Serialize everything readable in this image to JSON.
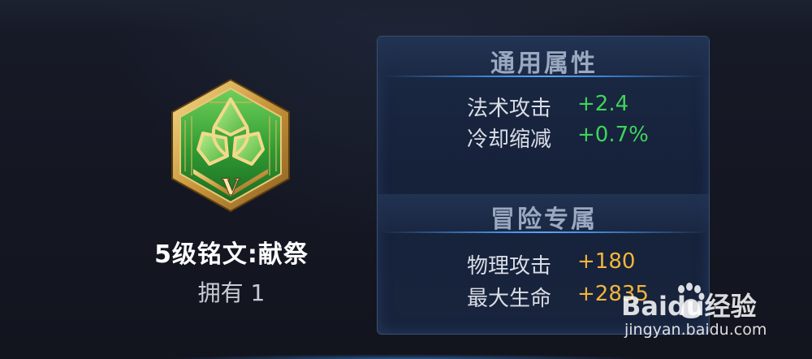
{
  "rune": {
    "name": "5级铭文:献祭",
    "owned": "拥有 1",
    "level_numeral": "V",
    "colors": {
      "face": "#3fa33a",
      "frame": "#d9b45a"
    }
  },
  "stats": {
    "general": {
      "title": "通用属性",
      "items": [
        {
          "label": "法术攻击",
          "value": "+2.4"
        },
        {
          "label": "冷却缩减",
          "value": "+0.7%"
        }
      ]
    },
    "adventure": {
      "title": "冒险专属",
      "items": [
        {
          "label": "物理攻击",
          "value": "+180"
        },
        {
          "label": "最大生命",
          "value": "+2835"
        }
      ]
    },
    "colors": {
      "positive": "#3fd45a",
      "adventure": "#f2b53a",
      "accent_line": "#3f8ce0"
    }
  },
  "watermark": {
    "brand": "Baidu经验",
    "url": "jingyan.baidu.com"
  }
}
